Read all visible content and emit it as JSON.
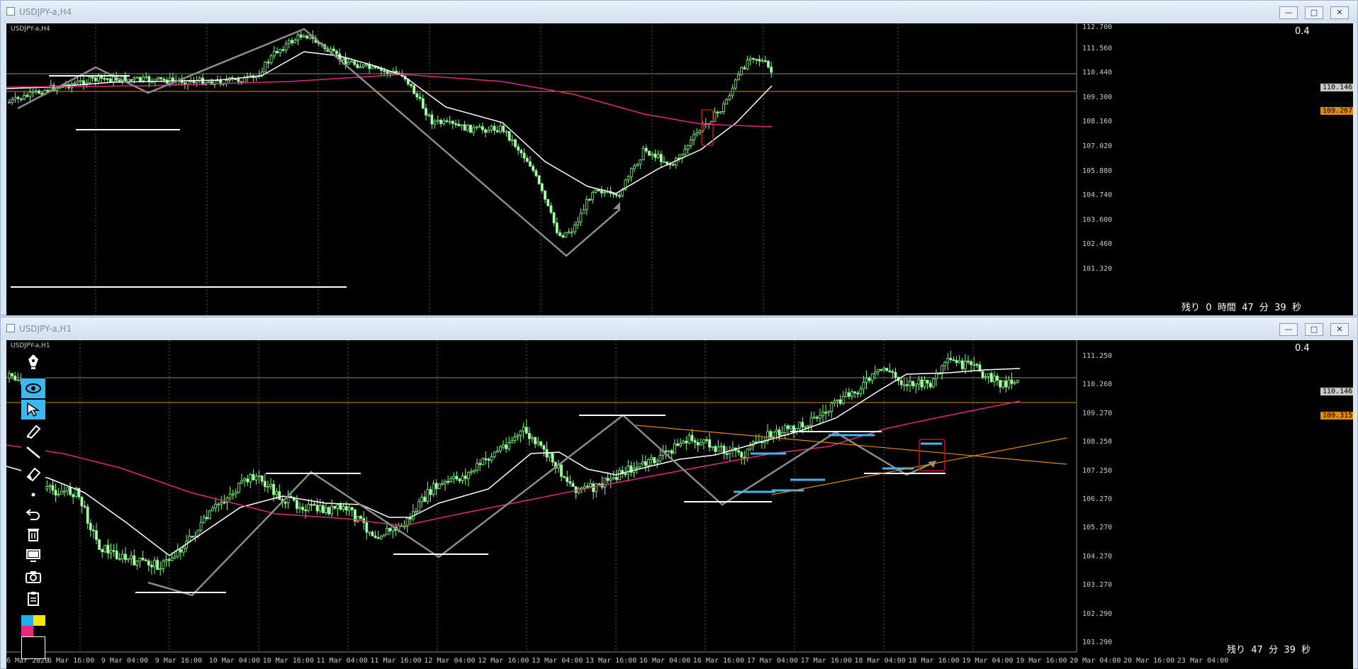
{
  "top_window": {
    "title": "USDJPY-a,H4",
    "symbol": "USDJPY-a,H4",
    "version": "0.4",
    "countdown": "残り  0  時間  47  分  39  秒",
    "price_labels": [
      "112.700",
      "111.560",
      "110.440",
      "109.300",
      "108.160",
      "107.020",
      "105.880",
      "104.740",
      "103.600",
      "102.460",
      "101.320"
    ],
    "current_price": "110.146",
    "line_price": "109.267"
  },
  "bottom_window": {
    "title": "USDJPY-a,H1",
    "symbol": "USDJPY-a,H1",
    "version": "0.4",
    "countdown": "残り  47  分  39  秒",
    "price_labels": [
      "111.250",
      "110.260",
      "109.270",
      "108.250",
      "107.250",
      "106.270",
      "105.270",
      "104.270",
      "103.270",
      "102.290",
      "101.290"
    ],
    "current_price": "110.146",
    "line_price": "109.315",
    "time_labels": [
      "6 Mar 2020",
      "6 Mar 16:00",
      "9 Mar 04:00",
      "9 Mar 16:00",
      "10 Mar 04:00",
      "10 Mar 16:00",
      "11 Mar 04:00",
      "11 Mar 16:00",
      "12 Mar 04:00",
      "12 Mar 16:00",
      "13 Mar 04:00",
      "13 Mar 16:00",
      "16 Mar 04:00",
      "16 Mar 16:00",
      "17 Mar 04:00",
      "17 Mar 16:00",
      "18 Mar 04:00",
      "18 Mar 16:00",
      "19 Mar 04:00",
      "19 Mar 16:00",
      "20 Mar 04:00",
      "20 Mar 16:00",
      "23 Mar 04:00"
    ]
  },
  "window_buttons": {
    "minimize": "—",
    "maximize": "□",
    "close": "✕"
  },
  "toolbar_items": [
    "pen-icon",
    "eye-icon",
    "cursor-icon",
    "pencil-icon",
    "line-icon",
    "eraser-icon",
    "dot-icon",
    "undo-icon",
    "trash-icon",
    "monitor-icon",
    "camera-icon",
    "clipboard-icon",
    "color-palette"
  ],
  "colors": {
    "accent": "#3db7ee",
    "ma_pink": "#e0277f",
    "line_orange": "#e08a00",
    "candle": "#7dff7d"
  }
}
